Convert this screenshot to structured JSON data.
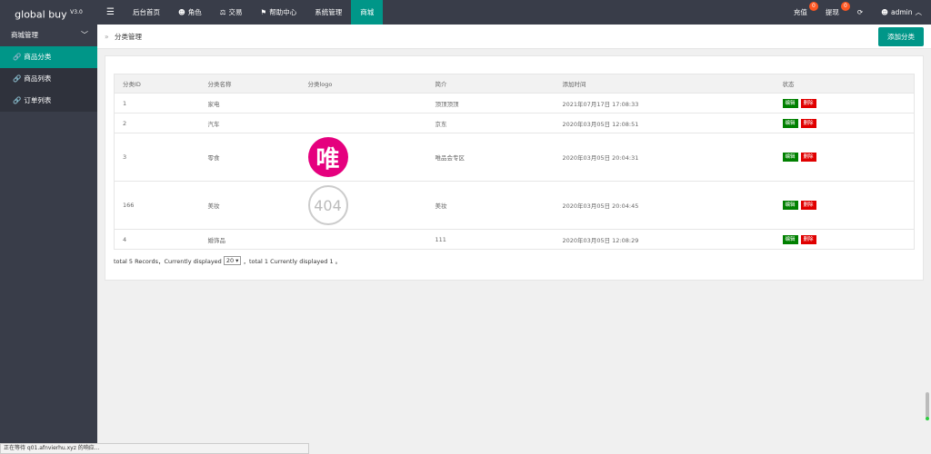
{
  "brand": {
    "name": "global buy",
    "version": "V3.0"
  },
  "topnav": [
    {
      "label": "",
      "icon": "menu-icon"
    },
    {
      "label": "后台首页"
    },
    {
      "label": "角色",
      "icon": "user-icon"
    },
    {
      "label": "交易",
      "icon": "scale-icon"
    },
    {
      "label": "帮助中心",
      "icon": "flag-icon"
    },
    {
      "label": "系统管理"
    },
    {
      "label": "商城"
    }
  ],
  "topright": {
    "recharge": "充值",
    "recharge_badge": "0",
    "withdraw": "提现",
    "withdraw_badge": "0",
    "user": "admin"
  },
  "sidebar": {
    "group": "商城管理",
    "items": [
      {
        "label": "商品分类"
      },
      {
        "label": "商品列表"
      },
      {
        "label": "订单列表"
      }
    ]
  },
  "header": {
    "breadcrumb": "分类管理",
    "add_button": "添加分类"
  },
  "table": {
    "columns": [
      "分类ID",
      "分类名称",
      "分类logo",
      "简介",
      "添加时间",
      "状态"
    ],
    "rows": [
      {
        "id": "1",
        "name": "家电",
        "logo": "",
        "intro": "顶顶顶顶",
        "time": "2021年07月17日 17:08:33"
      },
      {
        "id": "2",
        "name": "汽车",
        "logo": "",
        "intro": "京东",
        "time": "2020年03月05日 12:08:51"
      },
      {
        "id": "3",
        "name": "零食",
        "logo": "唯",
        "intro": "唯品会专区",
        "time": "2020年03月05日 20:04:31"
      },
      {
        "id": "166",
        "name": "美妆",
        "logo": "404",
        "intro": "美妆",
        "time": "2020年03月05日 20:04:45"
      },
      {
        "id": "4",
        "name": "婚饰品",
        "logo": "",
        "intro": "111",
        "time": "2020年03月05日 12:08:29"
      }
    ],
    "edit_label": "编辑",
    "delete_label": "删除"
  },
  "pager": {
    "prefix": "total 5 Records，Currently displayed",
    "page_size": "20",
    "suffix": "，total 1 Currently displayed 1 。"
  },
  "statusbar": "正在等待 q01.afnvierhu.xyz 的响应...",
  "colors": {
    "topbar": "#393d49",
    "accent": "#009688",
    "edit": "#008000",
    "delete": "#e00000"
  }
}
